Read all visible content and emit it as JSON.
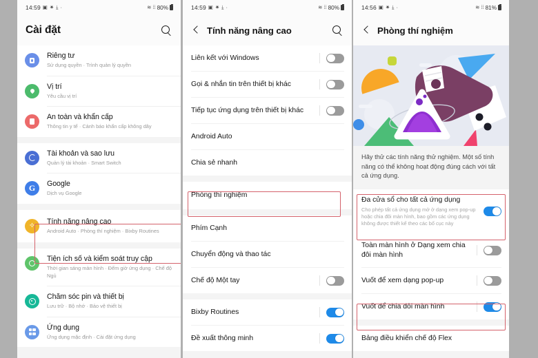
{
  "panels": [
    {
      "status": {
        "time": "14:59",
        "icons": [
          "picture-icon",
          "gear-icon",
          "download-icon",
          "dot-icon"
        ],
        "wifi": "wifi-icon",
        "signal": "signal-icon",
        "battery_pct": "80%"
      },
      "appbar": {
        "title": "Cài đặt",
        "search_icon": "search-icon",
        "has_back": false
      },
      "items": [
        {
          "title": "Riêng tư",
          "subtitle": "Sử dụng quyền  ·  Trình quản lý quyền",
          "icon": "lock-icon",
          "color": "#6a8fe8"
        },
        {
          "title": "Vị trí",
          "subtitle": "Yêu cầu vị trí",
          "icon": "location-pin-icon",
          "color": "#4cbb6c"
        },
        {
          "title": "An toàn và khẩn cấp",
          "subtitle": "Thông tin y tế  ·  Cảnh báo khẩn cấp không dây",
          "icon": "emergency-icon",
          "color": "#ec6a6a"
        },
        {
          "title": "Tài khoản và sao lưu",
          "subtitle": "Quản lý tài khoản  ·  Smart Switch",
          "icon": "sync-icon",
          "color": "#4a6fd4"
        },
        {
          "title": "Google",
          "subtitle": "Dịch vụ Google",
          "icon": "google-icon",
          "color": "#3f7ee8"
        },
        {
          "title": "Tính năng nâng cao",
          "subtitle": "Android Auto  ·  Phòng thí nghiệm  ·  Bixby Routines",
          "icon": "advanced-features-icon",
          "color": "#f0b429"
        },
        {
          "title": "Tiện ích số và kiểm soát truy cập",
          "subtitle": "Thời gian sáng màn hình  ·  Đếm giờ ứng dụng  ·  Chế độ Ngủ",
          "icon": "digital-wellbeing-icon",
          "color": "#5fc46a"
        },
        {
          "title": "Chăm sóc pin và thiết bị",
          "subtitle": "Lưu trữ  ·  Bộ nhớ  ·  Bảo vệ thiết bị",
          "icon": "device-care-icon",
          "color": "#17b897"
        },
        {
          "title": "Ứng dụng",
          "subtitle": "Ứng dụng mặc định  ·  Cài đặt ứng dụng",
          "icon": "apps-grid-icon",
          "color": "#6a9ae8"
        }
      ]
    },
    {
      "status": {
        "time": "14:59",
        "battery_pct": "80%"
      },
      "appbar": {
        "title": "Tính năng nâng cao",
        "search_icon": "search-icon",
        "back_icon": "back-arrow-icon",
        "has_back": true
      },
      "items": [
        {
          "label": "Liên kết với Windows",
          "toggle": "off"
        },
        {
          "label": "Gọi & nhắn tin trên thiết bị khác",
          "toggle": "off"
        },
        {
          "label": "Tiếp tục ứng dụng trên thiết bị khác",
          "toggle": "off"
        },
        {
          "label": "Android Auto",
          "toggle": "none"
        },
        {
          "label": "Chia sẻ nhanh",
          "toggle": "none"
        },
        {
          "label": "Phòng thí nghiệm",
          "toggle": "none",
          "highlight": true
        },
        {
          "label": "Phím Cạnh",
          "toggle": "none"
        },
        {
          "label": "Chuyển động và thao tác",
          "toggle": "none"
        },
        {
          "label": "Chế độ Một tay",
          "toggle": "off"
        },
        {
          "label": "Bixby Routines",
          "toggle": "on"
        },
        {
          "label": "Đề xuất thông minh",
          "toggle": "on"
        }
      ]
    },
    {
      "status": {
        "time": "14:56",
        "battery_pct": "81%"
      },
      "appbar": {
        "title": "Phòng thí nghiệm",
        "back_icon": "back-arrow-icon",
        "has_back": true,
        "has_search": false
      },
      "illustration": "lab-flask-illustration",
      "description": "Hãy thử các tính năng thử nghiệm. Một số tính năng có thể không hoạt động đúng cách với tất cả ứng dụng.",
      "items": [
        {
          "label": "Đa cửa sổ cho tất cả ứng dụng",
          "sub": "Cho phép tất cả ứng dụng mở ở dạng xem pop-up hoặc chia đôi màn hình, bao gồm các ứng dụng không được thiết kế theo các bố cục này",
          "toggle": "on",
          "highlight": true
        },
        {
          "label": "Toàn màn hình ở Dạng xem chia đôi màn hình",
          "toggle": "off"
        },
        {
          "label": "Vuốt để xem dạng pop-up",
          "toggle": "off"
        },
        {
          "label": "Vuốt để chia đôi màn hình",
          "toggle": "on",
          "highlight": true
        },
        {
          "label": "Bảng điều khiển chế độ Flex",
          "toggle": "none"
        }
      ]
    }
  ],
  "colors": {
    "highlight_border": "#d4616b",
    "toggle_on": "#1e8ae8",
    "toggle_off": "#9b9b9b",
    "page_background": "#b0b0b0"
  }
}
